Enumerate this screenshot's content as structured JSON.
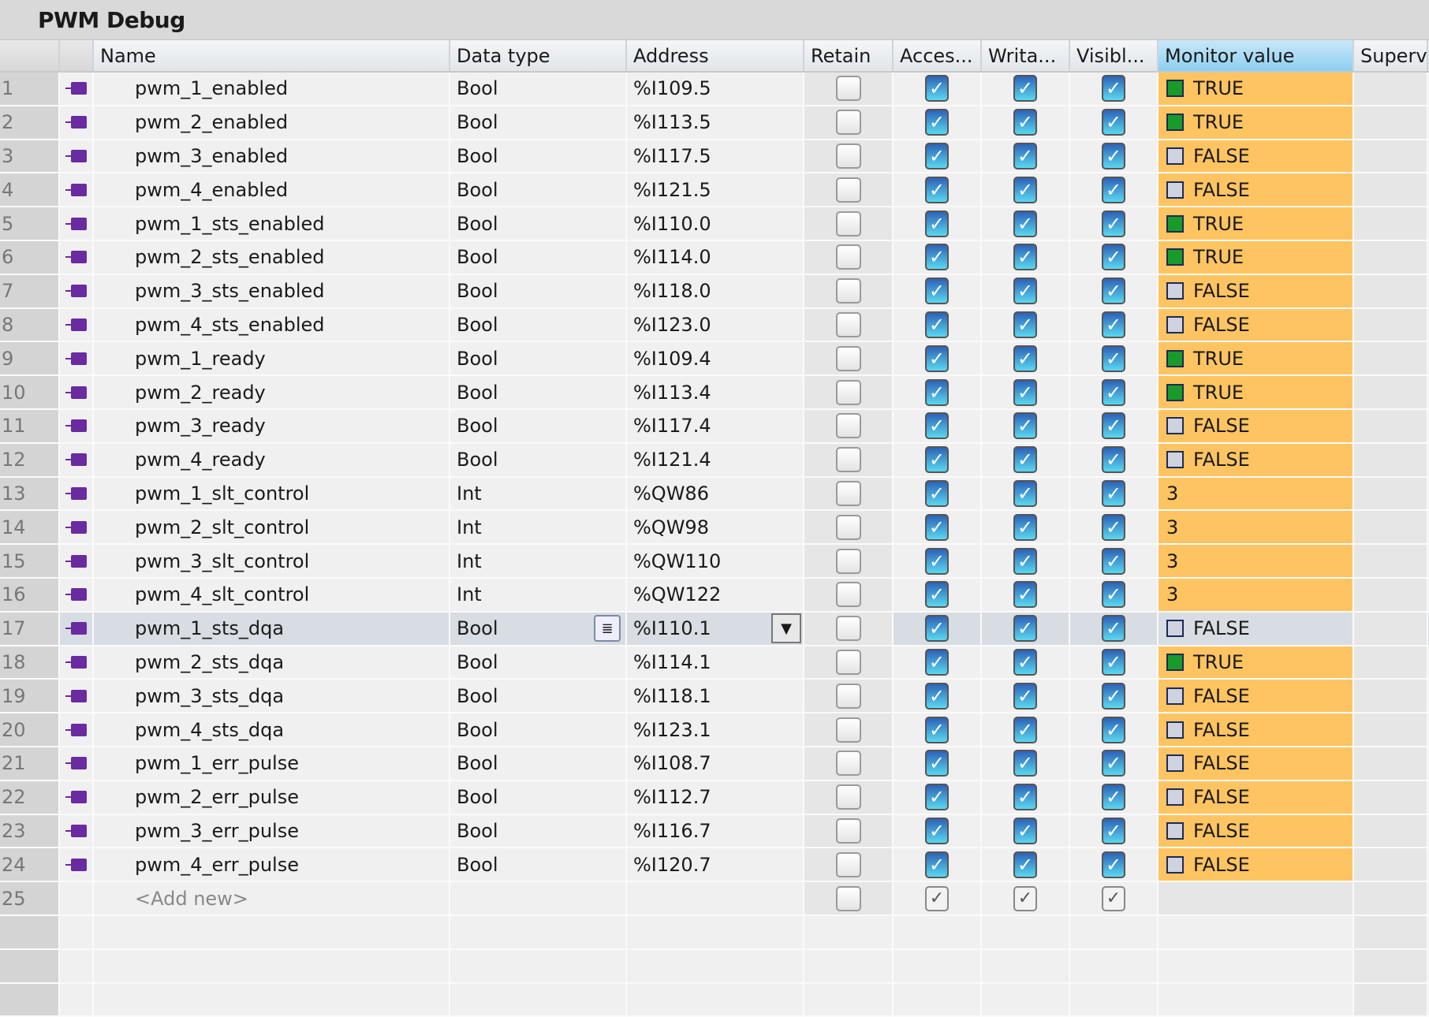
{
  "title": "PWM Debug",
  "columns": [
    "Name",
    "Data type",
    "Address",
    "Retain",
    "Acces...",
    "Writa...",
    "Visibl...",
    "Monitor value",
    "Supervi"
  ],
  "rows": [
    {
      "n": "1",
      "name": "pwm_1_enabled",
      "type": "Bool",
      "addr": "%I109.5",
      "val": "TRUE"
    },
    {
      "n": "2",
      "name": "pwm_2_enabled",
      "type": "Bool",
      "addr": "%I113.5",
      "val": "TRUE"
    },
    {
      "n": "3",
      "name": "pwm_3_enabled",
      "type": "Bool",
      "addr": "%I117.5",
      "val": "FALSE"
    },
    {
      "n": "4",
      "name": "pwm_4_enabled",
      "type": "Bool",
      "addr": "%I121.5",
      "val": "FALSE"
    },
    {
      "n": "5",
      "name": "pwm_1_sts_enabled",
      "type": "Bool",
      "addr": "%I110.0",
      "val": "TRUE"
    },
    {
      "n": "6",
      "name": "pwm_2_sts_enabled",
      "type": "Bool",
      "addr": "%I114.0",
      "val": "TRUE"
    },
    {
      "n": "7",
      "name": "pwm_3_sts_enabled",
      "type": "Bool",
      "addr": "%I118.0",
      "val": "FALSE"
    },
    {
      "n": "8",
      "name": "pwm_4_sts_enabled",
      "type": "Bool",
      "addr": "%I123.0",
      "val": "FALSE"
    },
    {
      "n": "9",
      "name": "pwm_1_ready",
      "type": "Bool",
      "addr": "%I109.4",
      "val": "TRUE"
    },
    {
      "n": "10",
      "name": "pwm_2_ready",
      "type": "Bool",
      "addr": "%I113.4",
      "val": "TRUE"
    },
    {
      "n": "11",
      "name": "pwm_3_ready",
      "type": "Bool",
      "addr": "%I117.4",
      "val": "FALSE"
    },
    {
      "n": "12",
      "name": "pwm_4_ready",
      "type": "Bool",
      "addr": "%I121.4",
      "val": "FALSE"
    },
    {
      "n": "13",
      "name": "pwm_1_slt_control",
      "type": "Int",
      "addr": "%QW86",
      "val": "3"
    },
    {
      "n": "14",
      "name": "pwm_2_slt_control",
      "type": "Int",
      "addr": "%QW98",
      "val": "3"
    },
    {
      "n": "15",
      "name": "pwm_3_slt_control",
      "type": "Int",
      "addr": "%QW110",
      "val": "3"
    },
    {
      "n": "16",
      "name": "pwm_4_slt_control",
      "type": "Int",
      "addr": "%QW122",
      "val": "3"
    },
    {
      "n": "17",
      "name": "pwm_1_sts_dqa",
      "type": "Bool",
      "addr": "%I110.1",
      "val": "FALSE",
      "selected": true
    },
    {
      "n": "18",
      "name": "pwm_2_sts_dqa",
      "type": "Bool",
      "addr": "%I114.1",
      "val": "TRUE"
    },
    {
      "n": "19",
      "name": "pwm_3_sts_dqa",
      "type": "Bool",
      "addr": "%I118.1",
      "val": "FALSE"
    },
    {
      "n": "20",
      "name": "pwm_4_sts_dqa",
      "type": "Bool",
      "addr": "%I123.1",
      "val": "FALSE"
    },
    {
      "n": "21",
      "name": "pwm_1_err_pulse",
      "type": "Bool",
      "addr": "%I108.7",
      "val": "FALSE"
    },
    {
      "n": "22",
      "name": "pwm_2_err_pulse",
      "type": "Bool",
      "addr": "%I112.7",
      "val": "FALSE"
    },
    {
      "n": "23",
      "name": "pwm_3_err_pulse",
      "type": "Bool",
      "addr": "%I116.7",
      "val": "FALSE"
    },
    {
      "n": "24",
      "name": "pwm_4_err_pulse",
      "type": "Bool",
      "addr": "%I120.7",
      "val": "FALSE"
    }
  ],
  "add_row": {
    "n": "25",
    "label": "<Add new>"
  },
  "colors": {
    "monitor_bg": "#ffc462",
    "led_true": "#1a9a2a"
  }
}
